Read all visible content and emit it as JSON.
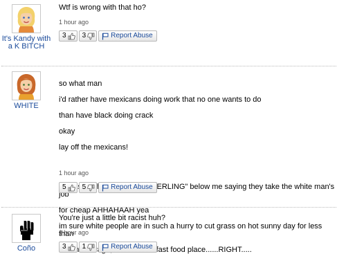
{
  "comments": [
    {
      "author": "It's Kandy with a K BITCH",
      "avatar_icon": "blonde-avatar-icon",
      "text": "Wtf is wrong with that ho?",
      "time": "1 hour ago",
      "thumbs_up": "3",
      "thumbs_down": "3",
      "report_label": "Report Abuse"
    },
    {
      "author": "WHITE",
      "avatar_icon": "redhead-avatar-icon",
      "text_lines": [
        "so what man",
        "i'd rather have mexicans doing work that no one wants to do",
        "than have black doing crack",
        "okay",
        "lay off the mexicans!"
      ],
      "text_para2_lines": [
        "and as for the white ***** \"STERLING\" below me saying they take the white man's job",
        "for cheap AHHAHAAH yea",
        "im sure white people are in such a hurry to cut grass on hot sunny day for less than",
        "minimum wage, or work at a fast food place......RIGHT....."
      ],
      "time": "1 hour ago",
      "thumbs_up": "5",
      "thumbs_down": "5",
      "report_label": "Report Abuse"
    },
    {
      "author": "Coño",
      "avatar_icon": "raised-fist-icon",
      "text": "You're just a little bit racist huh?",
      "time": "1 hour ago",
      "thumbs_up": "3",
      "thumbs_down": "1",
      "report_label": "Report Abuse"
    }
  ]
}
